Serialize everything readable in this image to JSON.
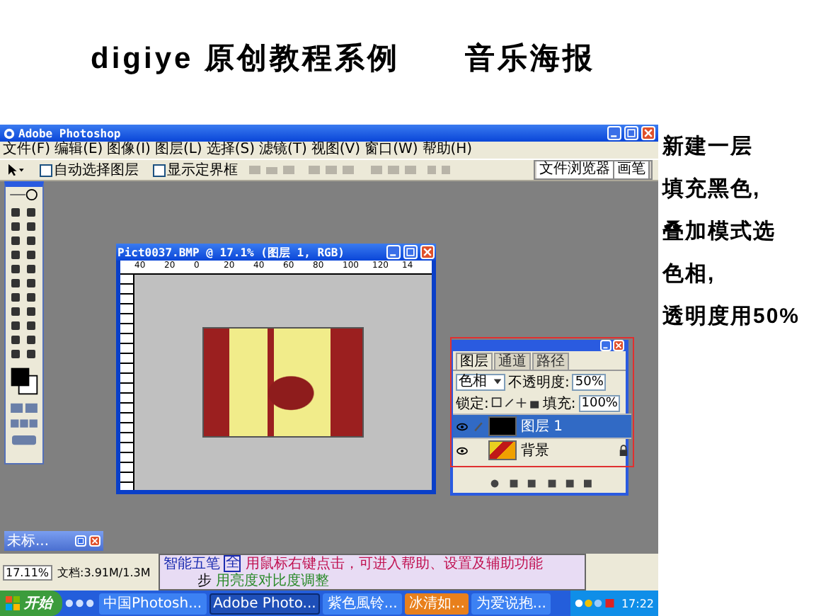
{
  "header": {
    "title": "digiye 原创教程系例",
    "subtitle": "音乐海报"
  },
  "photoshop": {
    "title": "Adobe Photoshop",
    "menu": [
      "文件(F)",
      "编辑(E)",
      "图像(I)",
      "图层(L)",
      "选择(S)",
      "滤镜(T)",
      "视图(V)",
      "窗口(W)",
      "帮助(H)"
    ],
    "options": [
      {
        "label": "自动选择图层",
        "checked": false
      },
      {
        "label": "显示定界框",
        "checked": false
      }
    ],
    "palette_well": [
      "文件浏览器",
      "画笔"
    ],
    "document": {
      "title": "Pict0037.BMP @ 17.1% (图层 1, RGB)",
      "ruler_labels": [
        "40",
        "20",
        "0",
        "20",
        "40",
        "60",
        "80",
        "100",
        "120",
        "14"
      ]
    },
    "layers_panel": {
      "tabs": [
        {
          "label": "图层",
          "selected": true
        },
        {
          "label": "通道",
          "selected": false
        },
        {
          "label": "路径",
          "selected": false
        }
      ],
      "blend_mode": "色相",
      "opacity_label": "不透明度:",
      "opacity": "50%",
      "lock_label": "锁定:",
      "fill_label": "填充:",
      "fill": "100%",
      "layers": [
        {
          "name": "图层 1",
          "kind": "fill",
          "selected": true,
          "locked": false
        },
        {
          "name": "背景",
          "kind": "image",
          "selected": false,
          "locked": true
        }
      ]
    },
    "minimized_window": {
      "title": "未标..."
    },
    "status": {
      "zoom": "17.11%",
      "doc_size": "文档:3.91M/1.3M"
    },
    "ime": {
      "name": "智能五笔",
      "mode": "全",
      "hint": "用鼠标右键点击，可进入帮助、设置及辅助功能",
      "step": "步",
      "step_text": "用亮度对比度调整"
    }
  },
  "taskbar": {
    "start": "开始",
    "tasks": [
      {
        "label": "中国Photosh...",
        "selected": false,
        "highlighted": false
      },
      {
        "label": "Adobe Photo...",
        "selected": true,
        "highlighted": false
      },
      {
        "label": "紫色風铃...",
        "selected": false,
        "highlighted": false
      },
      {
        "label": "冰清如...",
        "selected": false,
        "highlighted": true
      },
      {
        "label": "为爱说抱...",
        "selected": false,
        "highlighted": false
      }
    ],
    "clock": "17:22"
  },
  "notes": [
    "新建一层",
    "填充黑色,",
    "叠加模式选",
    "色相,",
    "透明度用50%"
  ]
}
